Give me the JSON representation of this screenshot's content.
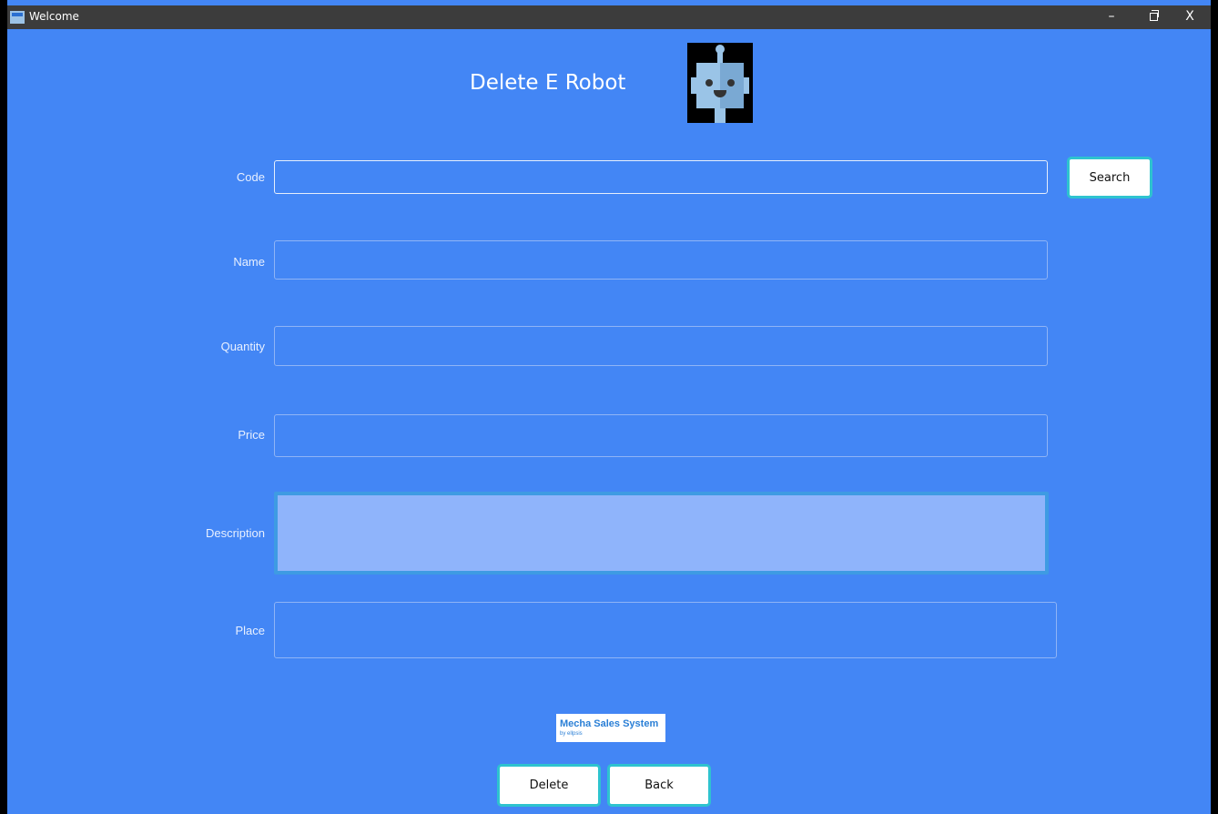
{
  "window": {
    "title": "Welcome",
    "controls": {
      "minimize": "–",
      "close": "X"
    }
  },
  "page": {
    "title": "Delete E Robot",
    "logo_icon": "robot-icon"
  },
  "form": {
    "code": {
      "label": "Code",
      "value": ""
    },
    "name": {
      "label": "Name",
      "value": ""
    },
    "quantity": {
      "label": "Quantity",
      "value": ""
    },
    "price": {
      "label": "Price",
      "value": ""
    },
    "description": {
      "label": "Description",
      "value": ""
    },
    "place": {
      "label": "Place",
      "value": ""
    }
  },
  "buttons": {
    "search": "Search",
    "delete": "Delete",
    "back": "Back"
  },
  "brand": {
    "name": "Mecha Sales System",
    "by": "by ellpsis"
  },
  "colors": {
    "background": "#4386f5",
    "titlebar": "#3c3c3c",
    "button_border": "#2ec3cf",
    "description_fill": "#8fb4fb"
  }
}
